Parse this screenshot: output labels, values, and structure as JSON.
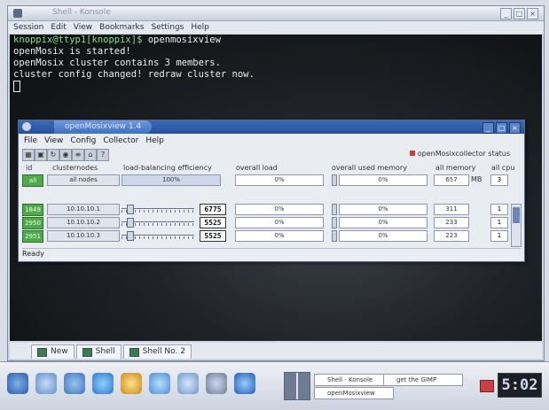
{
  "konsole": {
    "title": "Shell - Konsole",
    "menu": [
      "Session",
      "Edit",
      "View",
      "Bookmarks",
      "Settings",
      "Help"
    ],
    "lines": [
      {
        "prompt": "knoppix@ttyp1[knoppix]$",
        "text": " openmosixview"
      },
      {
        "prompt": "",
        "text": "openMosix is started!"
      },
      {
        "prompt": "",
        "text": "openMosix cluster contains 3 members."
      },
      {
        "prompt": "",
        "text": "cluster config changed! redraw cluster now."
      }
    ],
    "tabs": [
      "New",
      "Shell",
      "Shell No. 2"
    ]
  },
  "omv": {
    "title": "openMosixview 1.4",
    "menu": [
      "File",
      "View",
      "Config",
      "Collector",
      "Help"
    ],
    "status_label": "openMosixcollector status",
    "headers": {
      "id": "id",
      "clusternodes": "clusternodes",
      "lbe": "load-balancing efficiency",
      "load": "overall load",
      "mem": "overall used memory",
      "allmem": "all memory",
      "cpus": "all cpu"
    },
    "summary": {
      "id": "all",
      "nodes": "all nodes",
      "lbe": "100%",
      "load": "0%",
      "mem": "0%",
      "allmem": "657",
      "unit": "MB",
      "cpus": "3"
    },
    "rows": [
      {
        "id": "1849",
        "node": "10.10.10.1",
        "lbe": "6775",
        "load": "0%",
        "mem": "0%",
        "allmem": "311",
        "cpus": "1"
      },
      {
        "id": "2950",
        "node": "10.10.10.2",
        "lbe": "5525",
        "load": "0%",
        "mem": "0%",
        "allmem": "233",
        "cpus": "1"
      },
      {
        "id": "2951",
        "node": "10.10.10.3",
        "lbe": "5525",
        "load": "0%",
        "mem": "0%",
        "allmem": "223",
        "cpus": "1"
      }
    ],
    "ready": "Ready"
  },
  "taskbar": {
    "tasks": [
      "Shell - Konsole",
      "openMosixview"
    ],
    "tray_item": "get the GIMP",
    "clock": "5:02"
  }
}
